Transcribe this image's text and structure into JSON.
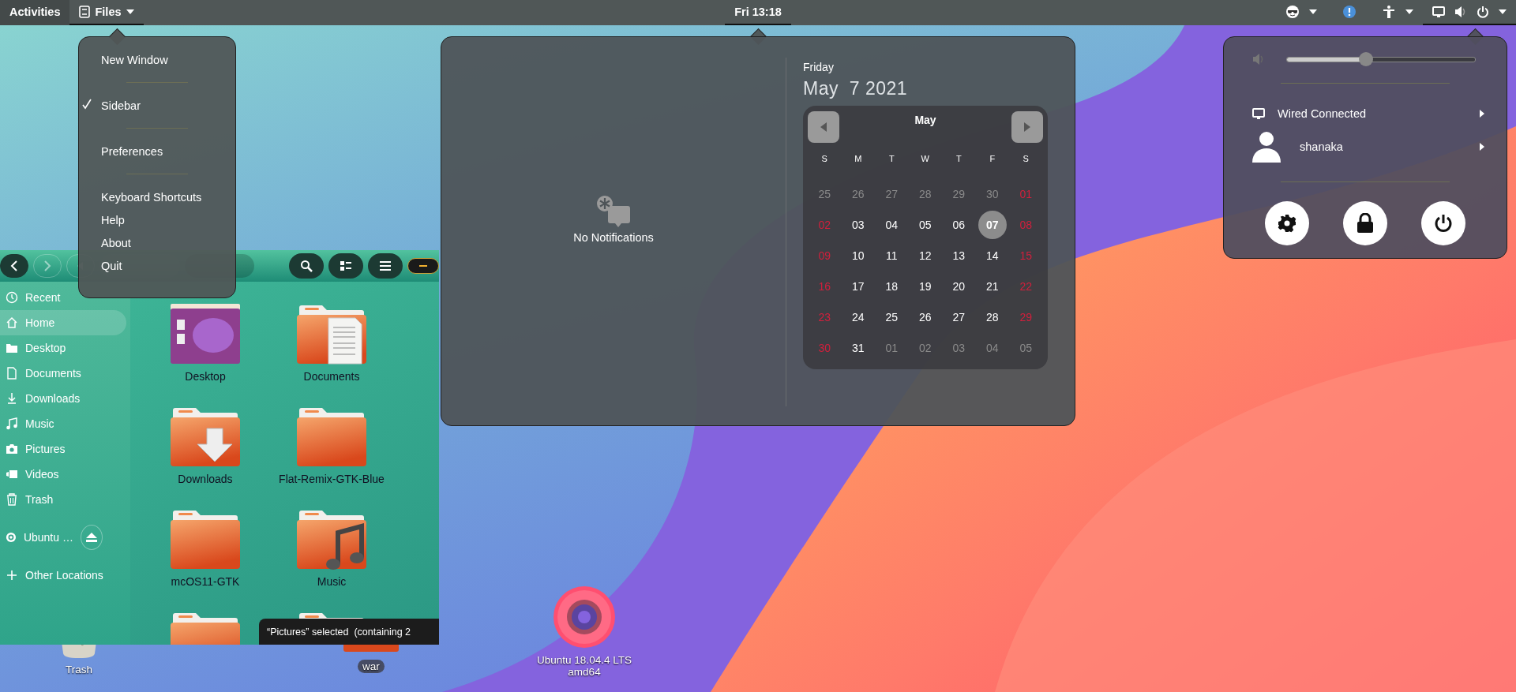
{
  "top_bar": {
    "activities": {
      "label": "Activities"
    },
    "app_button": {
      "label": "Files",
      "expanded": true
    },
    "clock": {
      "label": "Fri 13:18",
      "expanded": true
    },
    "system_status": {
      "expanded": true
    }
  },
  "app_menu": {
    "items": [
      {
        "kind": "item",
        "label": "New Window",
        "checked": false
      },
      {
        "kind": "separator"
      },
      {
        "kind": "item",
        "label": "Sidebar",
        "checked": true
      },
      {
        "kind": "separator"
      },
      {
        "kind": "item",
        "label": "Preferences",
        "checked": false
      },
      {
        "kind": "separator"
      },
      {
        "kind": "item",
        "label": "Keyboard Shortcuts",
        "checked": false
      },
      {
        "kind": "item",
        "label": "Help",
        "checked": false
      },
      {
        "kind": "item",
        "label": "About",
        "checked": false
      },
      {
        "kind": "item",
        "label": "Quit",
        "checked": false
      }
    ]
  },
  "files_window": {
    "sidebar": {
      "places": [
        {
          "label": "Recent",
          "selected": false
        },
        {
          "label": "Home",
          "selected": true
        },
        {
          "label": "Desktop",
          "selected": false
        },
        {
          "label": "Documents",
          "selected": false
        },
        {
          "label": "Downloads",
          "selected": false
        },
        {
          "label": "Music",
          "selected": false
        },
        {
          "label": "Pictures",
          "selected": false
        },
        {
          "label": "Videos",
          "selected": false
        },
        {
          "label": "Trash",
          "selected": false
        }
      ],
      "devices": [
        {
          "label": "Ubuntu …",
          "selected": false
        }
      ],
      "other": [
        {
          "label": "Other Locations",
          "selected": false
        }
      ]
    },
    "folders": [
      {
        "label": "Desktop"
      },
      {
        "label": "Documents"
      },
      {
        "label": "Downloads"
      },
      {
        "label": "Flat-Remix-GTK-Blue"
      },
      {
        "label": "mcOS11-GTK"
      },
      {
        "label": "Music"
      }
    ],
    "status_toast": "“Pictures” selected  (containing 2"
  },
  "desktop_icons": [
    {
      "label": "Trash",
      "selected": false
    },
    {
      "label": "war",
      "selected": true
    },
    {
      "label": "Ubuntu 18.04.4 LTS amd64",
      "selected": false
    }
  ],
  "calendar": {
    "notifications": "No Notifications",
    "weekday": "Friday",
    "date": "May  7 2021",
    "month": "May",
    "weekday_headers": [
      "S",
      "M",
      "T",
      "W",
      "T",
      "F",
      "S"
    ],
    "days": [
      {
        "label": "25",
        "kind": "other",
        "selected": false
      },
      {
        "label": "26",
        "kind": "other",
        "selected": false
      },
      {
        "label": "27",
        "kind": "other",
        "selected": false
      },
      {
        "label": "28",
        "kind": "other",
        "selected": false
      },
      {
        "label": "29",
        "kind": "other",
        "selected": false
      },
      {
        "label": "30",
        "kind": "other",
        "selected": false
      },
      {
        "label": "01",
        "kind": "weekend",
        "selected": false
      },
      {
        "label": "02",
        "kind": "weekend",
        "selected": false
      },
      {
        "label": "03",
        "kind": "weekday",
        "selected": false
      },
      {
        "label": "04",
        "kind": "weekday",
        "selected": false
      },
      {
        "label": "05",
        "kind": "weekday",
        "selected": false
      },
      {
        "label": "06",
        "kind": "weekday",
        "selected": false
      },
      {
        "label": "07",
        "kind": "weekday",
        "selected": true
      },
      {
        "label": "08",
        "kind": "weekend",
        "selected": false
      },
      {
        "label": "09",
        "kind": "weekend",
        "selected": false
      },
      {
        "label": "10",
        "kind": "weekday",
        "selected": false
      },
      {
        "label": "11",
        "kind": "weekday",
        "selected": false
      },
      {
        "label": "12",
        "kind": "weekday",
        "selected": false
      },
      {
        "label": "13",
        "kind": "weekday",
        "selected": false
      },
      {
        "label": "14",
        "kind": "weekday",
        "selected": false
      },
      {
        "label": "15",
        "kind": "weekend",
        "selected": false
      },
      {
        "label": "16",
        "kind": "weekend",
        "selected": false
      },
      {
        "label": "17",
        "kind": "weekday",
        "selected": false
      },
      {
        "label": "18",
        "kind": "weekday",
        "selected": false
      },
      {
        "label": "19",
        "kind": "weekday",
        "selected": false
      },
      {
        "label": "20",
        "kind": "weekday",
        "selected": false
      },
      {
        "label": "21",
        "kind": "weekday",
        "selected": false
      },
      {
        "label": "22",
        "kind": "weekend",
        "selected": false
      },
      {
        "label": "23",
        "kind": "weekend",
        "selected": false
      },
      {
        "label": "24",
        "kind": "weekday",
        "selected": false
      },
      {
        "label": "25",
        "kind": "weekday",
        "selected": false
      },
      {
        "label": "26",
        "kind": "weekday",
        "selected": false
      },
      {
        "label": "27",
        "kind": "weekday",
        "selected": false
      },
      {
        "label": "28",
        "kind": "weekday",
        "selected": false
      },
      {
        "label": "29",
        "kind": "weekend",
        "selected": false
      },
      {
        "label": "30",
        "kind": "weekend",
        "selected": false
      },
      {
        "label": "31",
        "kind": "weekday",
        "selected": false
      },
      {
        "label": "01",
        "kind": "other",
        "selected": false
      },
      {
        "label": "02",
        "kind": "other",
        "selected": false
      },
      {
        "label": "03",
        "kind": "other",
        "selected": false
      },
      {
        "label": "04",
        "kind": "other",
        "selected": false
      },
      {
        "label": "05",
        "kind": "other",
        "selected": false
      }
    ]
  },
  "system_menu": {
    "volume": {
      "level": 0.42
    },
    "network": {
      "label": "Wired Connected"
    },
    "user": {
      "label": "shanaka"
    }
  }
}
